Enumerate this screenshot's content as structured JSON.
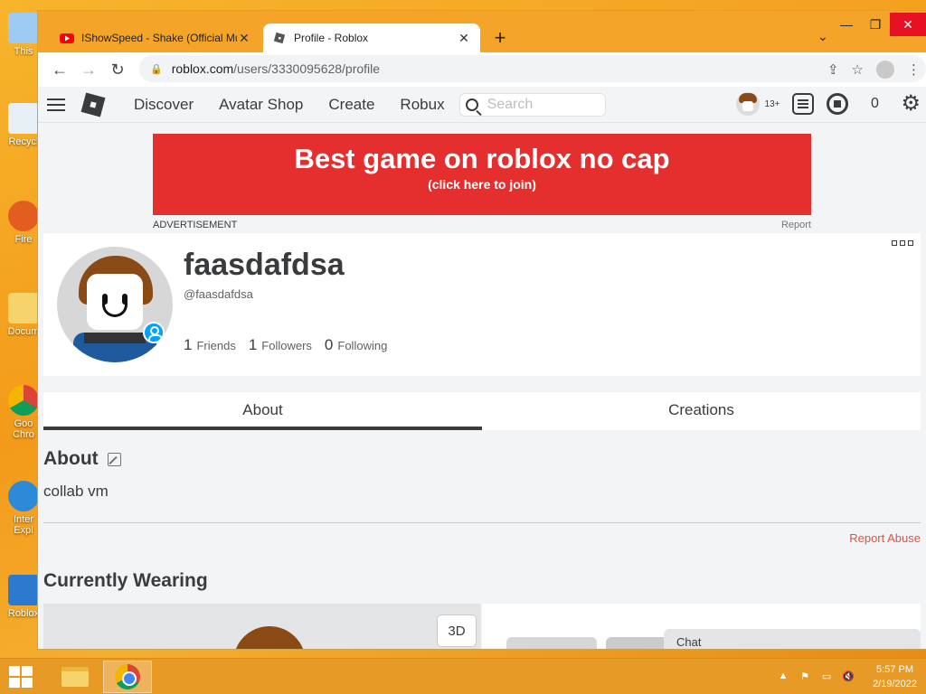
{
  "browser": {
    "tabs": [
      {
        "title": "IShowSpeed - Shake (Official Mu",
        "favicon": "youtube-icon",
        "active": false
      },
      {
        "title": "Profile - Roblox",
        "favicon": "roblox-icon",
        "active": true
      }
    ],
    "url_host": "roblox.com",
    "url_path": "/users/3330095628/profile"
  },
  "nav": {
    "links": [
      "Discover",
      "Avatar Shop",
      "Create",
      "Robux"
    ],
    "search_placeholder": "Search",
    "age_badge": "13+",
    "robux_count": "0"
  },
  "ad": {
    "title": "Best game on roblox no cap",
    "subtitle": "(click here to join)",
    "label": "ADVERTISEMENT",
    "report": "Report"
  },
  "profile": {
    "display_name": "faasdafdsa",
    "username": "@faasdafdsa",
    "friends_count": "1",
    "friends_label": "Friends",
    "followers_count": "1",
    "followers_label": "Followers",
    "following_count": "0",
    "following_label": "Following"
  },
  "profile_tabs": [
    "About",
    "Creations"
  ],
  "about": {
    "heading": "About",
    "text": "collab vm",
    "report_abuse": "Report Abuse"
  },
  "wearing": {
    "heading": "Currently Wearing",
    "toggle_3d": "3D"
  },
  "chat": {
    "label": "Chat"
  },
  "taskbar": {
    "time": "5:57 PM",
    "date": "2/19/2022"
  },
  "desktop_icons": [
    "This",
    "Recycl",
    "Fire",
    "Docum",
    "Goo Chro",
    "Inter Expl",
    "Roblox"
  ],
  "colors": {
    "accent": "#e52e2e",
    "roblox_text": "#393b3d",
    "report_red": "#d8544f",
    "online_blue": "#00a2ff"
  }
}
